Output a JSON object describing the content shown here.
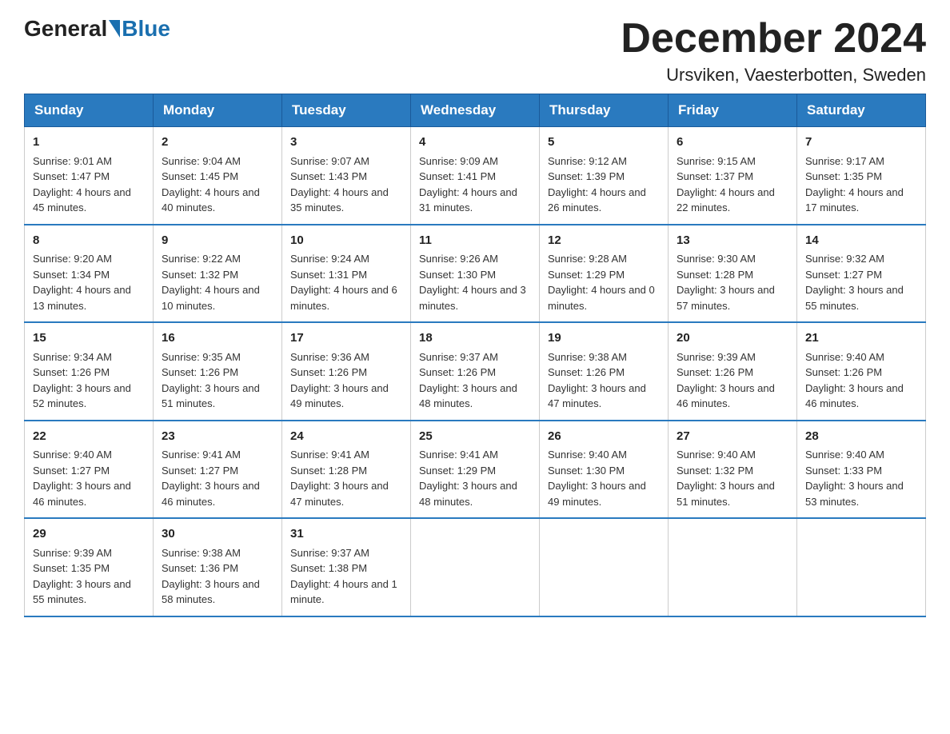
{
  "header": {
    "logo": {
      "general": "General",
      "blue": "Blue"
    },
    "title": "December 2024",
    "subtitle": "Ursviken, Vaesterbotten, Sweden"
  },
  "calendar": {
    "headers": [
      "Sunday",
      "Monday",
      "Tuesday",
      "Wednesday",
      "Thursday",
      "Friday",
      "Saturday"
    ],
    "rows": [
      [
        {
          "day": "1",
          "sunrise": "9:01 AM",
          "sunset": "1:47 PM",
          "daylight": "4 hours and 45 minutes."
        },
        {
          "day": "2",
          "sunrise": "9:04 AM",
          "sunset": "1:45 PM",
          "daylight": "4 hours and 40 minutes."
        },
        {
          "day": "3",
          "sunrise": "9:07 AM",
          "sunset": "1:43 PM",
          "daylight": "4 hours and 35 minutes."
        },
        {
          "day": "4",
          "sunrise": "9:09 AM",
          "sunset": "1:41 PM",
          "daylight": "4 hours and 31 minutes."
        },
        {
          "day": "5",
          "sunrise": "9:12 AM",
          "sunset": "1:39 PM",
          "daylight": "4 hours and 26 minutes."
        },
        {
          "day": "6",
          "sunrise": "9:15 AM",
          "sunset": "1:37 PM",
          "daylight": "4 hours and 22 minutes."
        },
        {
          "day": "7",
          "sunrise": "9:17 AM",
          "sunset": "1:35 PM",
          "daylight": "4 hours and 17 minutes."
        }
      ],
      [
        {
          "day": "8",
          "sunrise": "9:20 AM",
          "sunset": "1:34 PM",
          "daylight": "4 hours and 13 minutes."
        },
        {
          "day": "9",
          "sunrise": "9:22 AM",
          "sunset": "1:32 PM",
          "daylight": "4 hours and 10 minutes."
        },
        {
          "day": "10",
          "sunrise": "9:24 AM",
          "sunset": "1:31 PM",
          "daylight": "4 hours and 6 minutes."
        },
        {
          "day": "11",
          "sunrise": "9:26 AM",
          "sunset": "1:30 PM",
          "daylight": "4 hours and 3 minutes."
        },
        {
          "day": "12",
          "sunrise": "9:28 AM",
          "sunset": "1:29 PM",
          "daylight": "4 hours and 0 minutes."
        },
        {
          "day": "13",
          "sunrise": "9:30 AM",
          "sunset": "1:28 PM",
          "daylight": "3 hours and 57 minutes."
        },
        {
          "day": "14",
          "sunrise": "9:32 AM",
          "sunset": "1:27 PM",
          "daylight": "3 hours and 55 minutes."
        }
      ],
      [
        {
          "day": "15",
          "sunrise": "9:34 AM",
          "sunset": "1:26 PM",
          "daylight": "3 hours and 52 minutes."
        },
        {
          "day": "16",
          "sunrise": "9:35 AM",
          "sunset": "1:26 PM",
          "daylight": "3 hours and 51 minutes."
        },
        {
          "day": "17",
          "sunrise": "9:36 AM",
          "sunset": "1:26 PM",
          "daylight": "3 hours and 49 minutes."
        },
        {
          "day": "18",
          "sunrise": "9:37 AM",
          "sunset": "1:26 PM",
          "daylight": "3 hours and 48 minutes."
        },
        {
          "day": "19",
          "sunrise": "9:38 AM",
          "sunset": "1:26 PM",
          "daylight": "3 hours and 47 minutes."
        },
        {
          "day": "20",
          "sunrise": "9:39 AM",
          "sunset": "1:26 PM",
          "daylight": "3 hours and 46 minutes."
        },
        {
          "day": "21",
          "sunrise": "9:40 AM",
          "sunset": "1:26 PM",
          "daylight": "3 hours and 46 minutes."
        }
      ],
      [
        {
          "day": "22",
          "sunrise": "9:40 AM",
          "sunset": "1:27 PM",
          "daylight": "3 hours and 46 minutes."
        },
        {
          "day": "23",
          "sunrise": "9:41 AM",
          "sunset": "1:27 PM",
          "daylight": "3 hours and 46 minutes."
        },
        {
          "day": "24",
          "sunrise": "9:41 AM",
          "sunset": "1:28 PM",
          "daylight": "3 hours and 47 minutes."
        },
        {
          "day": "25",
          "sunrise": "9:41 AM",
          "sunset": "1:29 PM",
          "daylight": "3 hours and 48 minutes."
        },
        {
          "day": "26",
          "sunrise": "9:40 AM",
          "sunset": "1:30 PM",
          "daylight": "3 hours and 49 minutes."
        },
        {
          "day": "27",
          "sunrise": "9:40 AM",
          "sunset": "1:32 PM",
          "daylight": "3 hours and 51 minutes."
        },
        {
          "day": "28",
          "sunrise": "9:40 AM",
          "sunset": "1:33 PM",
          "daylight": "3 hours and 53 minutes."
        }
      ],
      [
        {
          "day": "29",
          "sunrise": "9:39 AM",
          "sunset": "1:35 PM",
          "daylight": "3 hours and 55 minutes."
        },
        {
          "day": "30",
          "sunrise": "9:38 AM",
          "sunset": "1:36 PM",
          "daylight": "3 hours and 58 minutes."
        },
        {
          "day": "31",
          "sunrise": "9:37 AM",
          "sunset": "1:38 PM",
          "daylight": "4 hours and 1 minute."
        },
        null,
        null,
        null,
        null
      ]
    ],
    "labels": {
      "sunrise": "Sunrise:",
      "sunset": "Sunset:",
      "daylight": "Daylight:"
    }
  }
}
